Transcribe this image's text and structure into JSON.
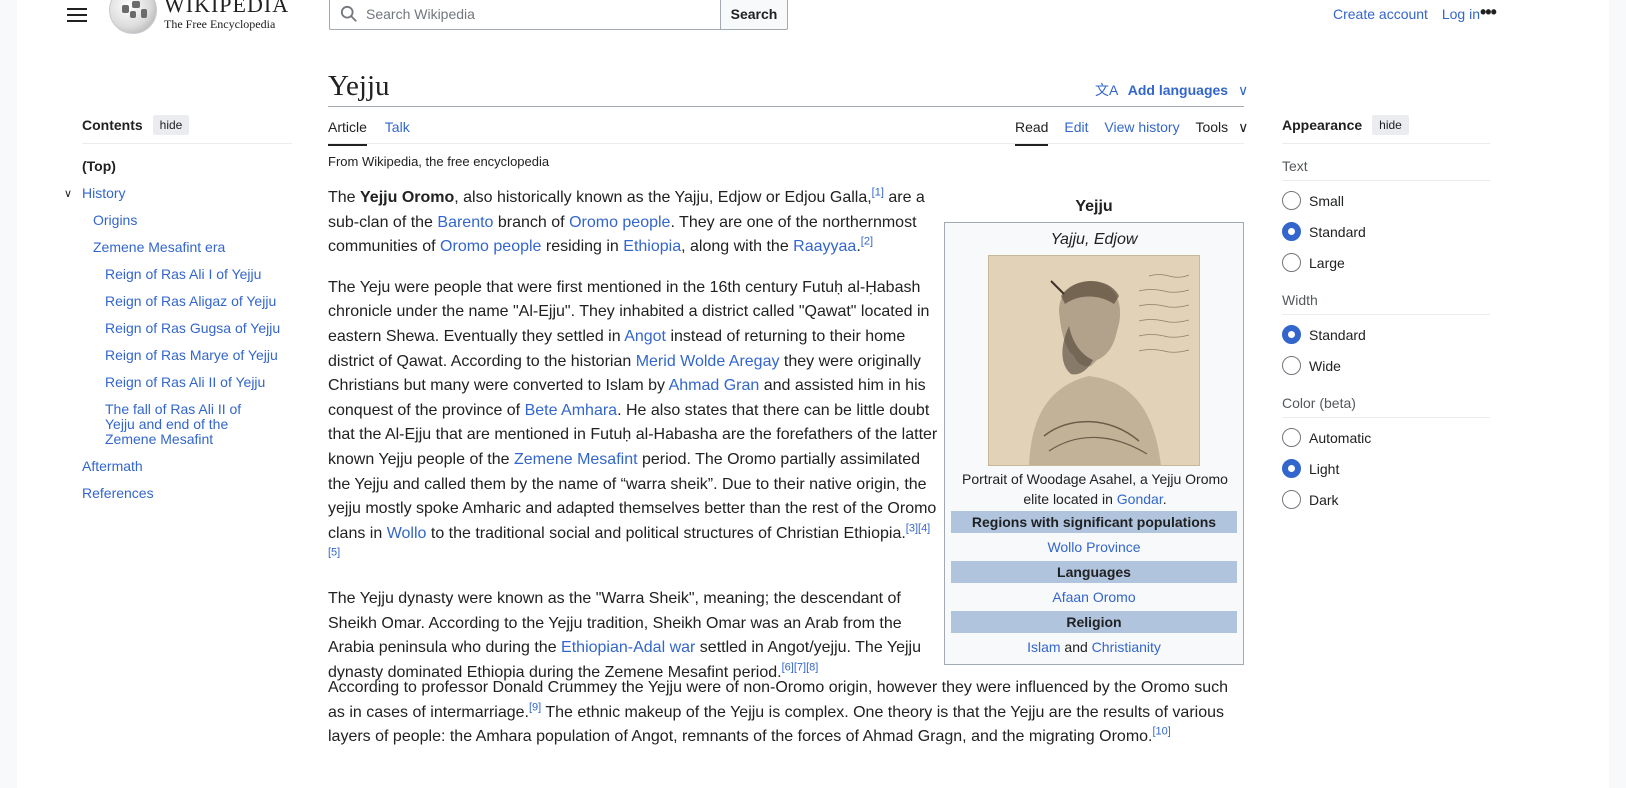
{
  "header": {
    "wordmark": "WIKIPEDIA",
    "tagline": "The Free Encyclopedia",
    "search_placeholder": "Search Wikipedia",
    "search_button": "Search",
    "create_account": "Create account",
    "log_in": "Log in",
    "more": "•••"
  },
  "toc": {
    "title": "Contents",
    "hide": "hide",
    "items": [
      {
        "label": "(Top)"
      },
      {
        "label": "History"
      },
      {
        "label": "Origins"
      },
      {
        "label": "Zemene Mesafint era"
      },
      {
        "label": "Reign of Ras Ali I of Yejju"
      },
      {
        "label": "Reign of Ras Aligaz of Yejju"
      },
      {
        "label": "Reign of Ras Gugsa of Yejju"
      },
      {
        "label": "Reign of Ras Marye of Yejju"
      },
      {
        "label": "Reign of Ras Ali II of Yejju"
      },
      {
        "label": "The fall of Ras Ali II of Yejju and end of the Zemene Mesafint"
      },
      {
        "label": "Aftermath"
      },
      {
        "label": "References"
      }
    ]
  },
  "article": {
    "title": "Yejju",
    "add_languages": "Add languages",
    "tabs_left": [
      "Article",
      "Talk"
    ],
    "tabs_right": [
      "Read",
      "Edit",
      "View history",
      "Tools"
    ],
    "from": "From Wikipedia, the free encyclopedia",
    "p1": {
      "a": "The ",
      "bold": "Yejju Oromo",
      "b": ", also historically known as the Yajju, Edjow or Edjou Galla,",
      "ref1": "[1]",
      "c": " are a sub-clan of the ",
      "link1": "Barento",
      "d": " branch of ",
      "link2": "Oromo people",
      "e": ". They are one of the northernmost communities of ",
      "link3": "Oromo people",
      "f": " residing in ",
      "link4": "Ethiopia",
      "g": ", along with the ",
      "link5": "Raayyaa",
      "h": ".",
      "ref2": "[2]"
    },
    "p2": {
      "a": "The Yeju were people that were first mentioned in the 16th century Futuḥ al-Ḥabash chronicle under the name \"Al-Ejju\". They inhabited a district called \"Qawat\" located in eastern Shewa. Eventually they settled in ",
      "link1": "Angot",
      "b": " instead of returning to their home district of Qawat. According to the historian ",
      "link2": "Merid Wolde Aregay",
      "c": " they were originally Christians but many were converted to Islam by ",
      "link3": "Ahmad Gran",
      "d": " and assisted him in his conquest of the province of ",
      "link4": "Bete Amhara",
      "e": ". He also states that there can be little doubt that the Al-Ejju that are mentioned in Futuḥ al-Habasha are the forefathers of the latter known Yejju people of the ",
      "link5": "Zemene Mesafint",
      "f": " period. The Oromo partially assimilated the Yejju and called them by the name of “warra sheik”. Due to their native origin, the yejju mostly spoke Amharic and adapted themselves better than the rest of the Oromo clans in ",
      "link6": "Wollo",
      "g": " to the traditional social and political structures of Christian Ethiopia.",
      "refs": "[3][4][5]"
    },
    "p3": {
      "a": "The Yejju dynasty were known as the \"Warra Sheik\", meaning; the descendant of Sheikh Omar. According to the Yejju tradition, Sheikh Omar was an Arab from the Arabia peninsula who during the ",
      "link1": "Ethiopian-Adal war",
      "b": " settled in Angot/yejju. The Yejju dynasty dominated Ethiopia during the Zemene Mesafint period.",
      "refs": "[6][7][8]"
    },
    "p4": {
      "a": "According to professor Donald Crummey the Yejju were of non-Oromo origin, however they were influenced by the Oromo such as in cases of intermarriage.",
      "ref1": "[9]",
      "b": " The ethnic makeup of the Yejju is complex. One theory is that the Yejju are the results of various layers of people: the Amhara population of Angot, remnants of the forces of Ahmad Gragn, and the migrating Oromo.",
      "ref2": "[10]"
    }
  },
  "infobox": {
    "title": "Yejju",
    "subtitle": "Yajju, Edjow",
    "caption_a": "Portrait of Woodage Asahel, a Yejju Oromo elite located in ",
    "caption_link": "Gondar",
    "caption_b": ".",
    "portrait_signature": "Woodage Asahel",
    "h_regions": "Regions with significant populations",
    "regions": "Wollo Province",
    "h_languages": "Languages",
    "languages": "Afaan Oromo",
    "h_religion": "Religion",
    "religion_a": "Islam",
    "religion_and": " and ",
    "religion_b": "Christianity"
  },
  "appearance": {
    "title": "Appearance",
    "hide": "hide",
    "text_label": "Text",
    "text_options": [
      "Small",
      "Standard",
      "Large"
    ],
    "text_selected": "Standard",
    "width_label": "Width",
    "width_options": [
      "Standard",
      "Wide"
    ],
    "width_selected": "Standard",
    "color_label": "Color (beta)",
    "color_options": [
      "Automatic",
      "Light",
      "Dark"
    ],
    "color_selected": "Light"
  },
  "colors": {
    "link": "#3366cc",
    "infobox_header": "#b0c4de",
    "radio_on": "#3366cc"
  }
}
